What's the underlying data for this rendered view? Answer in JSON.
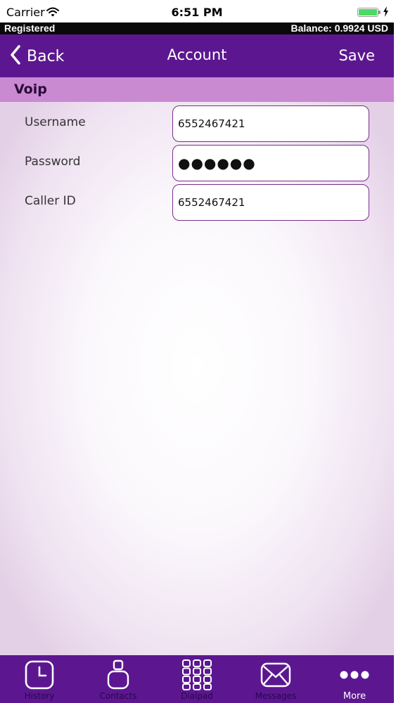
{
  "status_bar": {
    "carrier": "Carrier",
    "time": "6:51 PM"
  },
  "registration": {
    "status": "Registered",
    "balance": "Balance: 0.9924 USD"
  },
  "nav": {
    "back_label": "Back",
    "title": "Account",
    "save_label": "Save"
  },
  "section": {
    "title": "Voip"
  },
  "form": {
    "username": {
      "label": "Username",
      "value": "6552467421"
    },
    "password": {
      "label": "Password",
      "value": "●●●●●●"
    },
    "caller_id": {
      "label": "Caller ID",
      "value": "6552467421"
    }
  },
  "tabs": [
    {
      "label": "History",
      "icon": "clock-icon"
    },
    {
      "label": "Contacts",
      "icon": "person-icon"
    },
    {
      "label": "Dialpad",
      "icon": "dialpad-icon"
    },
    {
      "label": "Messages",
      "icon": "envelope-icon"
    },
    {
      "label": "More",
      "icon": "more-icon",
      "active": true
    }
  ],
  "colors": {
    "brand_purple": "#5c1790",
    "section_purple": "#c98ad2",
    "field_border": "#7a2e8c",
    "battery_green": "#4cd964"
  }
}
